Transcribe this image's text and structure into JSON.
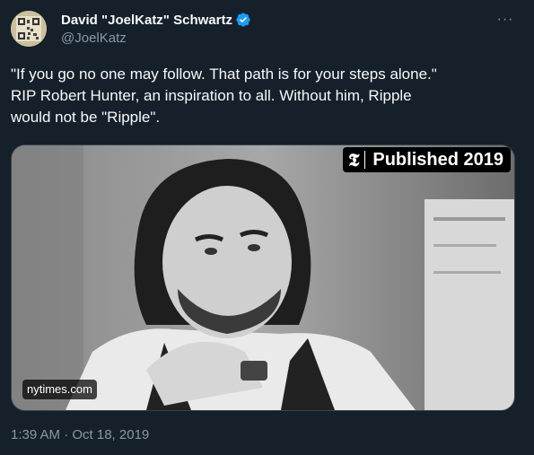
{
  "author": {
    "display_name": "David \"JoelKatz\" Schwartz",
    "handle": "@JoelKatz",
    "verified_icon": "verified-badge-icon"
  },
  "tweet": {
    "text": "\"If you go no one may follow. That path is for your steps alone.\"\nRIP Robert Hunter, an inspiration to all. Without him, Ripple\nwould not be \"Ripple\".",
    "timestamp": "1:39 AM · Oct 18, 2019"
  },
  "media": {
    "published_label": "Published 2019",
    "publisher_logo": "𝕿",
    "source_label": "nytimes.com"
  },
  "menu": {
    "more_icon": "···"
  },
  "colors": {
    "background": "#15202b",
    "text_primary": "#f7f9f9",
    "text_secondary": "#8b98a5",
    "verified_blue": "#1d9bf0"
  }
}
